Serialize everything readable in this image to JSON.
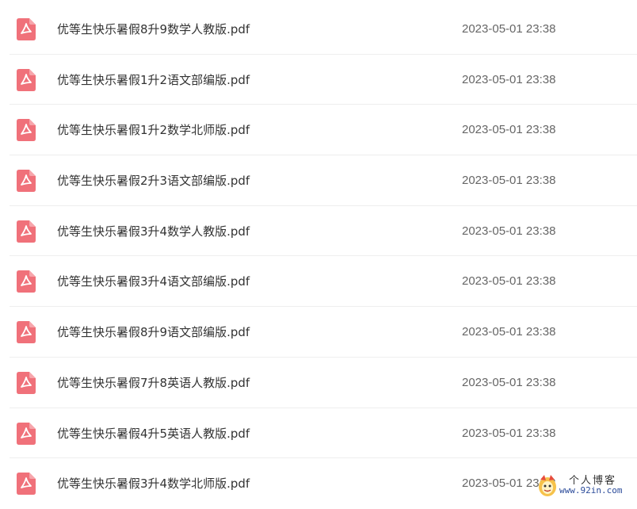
{
  "icon": "pdf-file-icon",
  "colors": {
    "icon_bg": "#f0717a",
    "icon_glyph": "#ffffff",
    "name_text": "#333333",
    "time_text": "#666666",
    "divider": "#eeeeee"
  },
  "files": [
    {
      "name": "优等生快乐暑假8升9数学人教版.pdf",
      "time": "2023-05-01 23:38"
    },
    {
      "name": "优等生快乐暑假1升2语文部编版.pdf",
      "time": "2023-05-01 23:38"
    },
    {
      "name": "优等生快乐暑假1升2数学北师版.pdf",
      "time": "2023-05-01 23:38"
    },
    {
      "name": "优等生快乐暑假2升3语文部编版.pdf",
      "time": "2023-05-01 23:38"
    },
    {
      "name": "优等生快乐暑假3升4数学人教版.pdf",
      "time": "2023-05-01 23:38"
    },
    {
      "name": "优等生快乐暑假3升4语文部编版.pdf",
      "time": "2023-05-01 23:38"
    },
    {
      "name": "优等生快乐暑假8升9语文部编版.pdf",
      "time": "2023-05-01 23:38"
    },
    {
      "name": "优等生快乐暑假7升8英语人教版.pdf",
      "time": "2023-05-01 23:38"
    },
    {
      "name": "优等生快乐暑假4升5英语人教版.pdf",
      "time": "2023-05-01 23:38"
    },
    {
      "name": "优等生快乐暑假3升4数学北师版.pdf",
      "time": "2023-05-01 23:38"
    }
  ],
  "watermark": {
    "title": "个人博客",
    "url": "www.92in.com"
  }
}
